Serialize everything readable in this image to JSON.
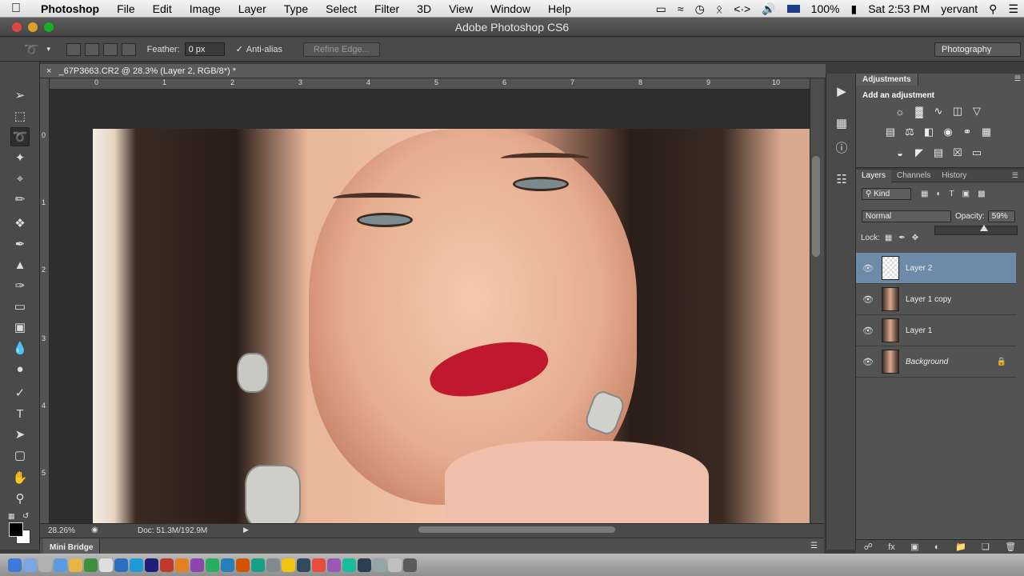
{
  "menubar": {
    "apple": "",
    "items": [
      "Photoshop",
      "File",
      "Edit",
      "Image",
      "Layer",
      "Type",
      "Select",
      "Filter",
      "3D",
      "View",
      "Window",
      "Help"
    ],
    "battery": "100%",
    "clock": "Sat 2:53 PM",
    "user": "yervant"
  },
  "window": {
    "title": "Adobe Photoshop CS6"
  },
  "options": {
    "feather_label": "Feather:",
    "feather_value": "0 px",
    "antialias_label": "Anti-alias",
    "refine_edge": "Refine Edge...",
    "workspace": "Photography"
  },
  "document": {
    "tab_title": "_67P3663.CR2 @ 28.3% (Layer 2, RGB/8*) *",
    "ruler_top": [
      "0",
      "1",
      "2",
      "3",
      "4",
      "5",
      "6",
      "7",
      "8",
      "9",
      "10"
    ],
    "ruler_left": [
      "0",
      "1",
      "2",
      "3",
      "4",
      "5"
    ],
    "zoom": "28.26%",
    "doc_size": "Doc: 51.3M/192.9M",
    "mini_bridge": "Mini Bridge"
  },
  "adjustments": {
    "tab": "Adjustments",
    "heading": "Add an adjustment"
  },
  "layers_panel": {
    "tabs": [
      "Layers",
      "Channels",
      "History"
    ],
    "filter_kind": "Kind",
    "blend_mode": "Normal",
    "opacity_label": "Opacity:",
    "opacity_value": "59%",
    "lock_label": "Lock:",
    "layers": [
      {
        "name": "Layer 2",
        "selected": true
      },
      {
        "name": "Layer 1 copy",
        "selected": false
      },
      {
        "name": "Layer 1",
        "selected": false
      },
      {
        "name": "Background",
        "selected": false
      }
    ]
  },
  "colors": {
    "selected_layer": "#6d8aa8",
    "panel_bg": "#535353"
  }
}
